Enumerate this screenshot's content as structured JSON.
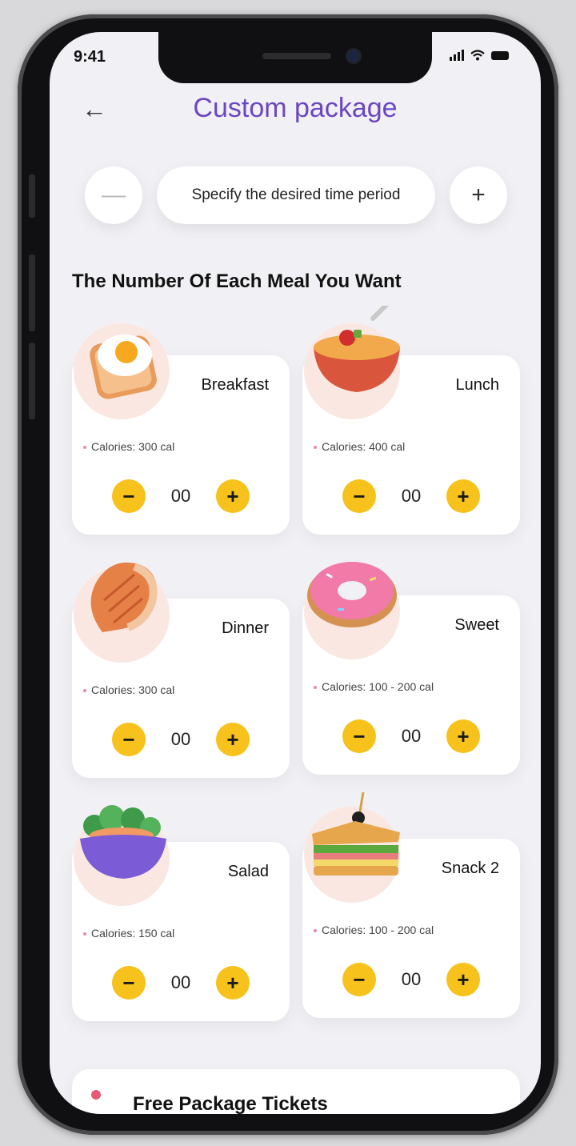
{
  "status_bar": {
    "time": "9:41"
  },
  "header": {
    "title": "Custom package"
  },
  "period": {
    "minus_label": "—",
    "label": "Specify the desired time period",
    "plus_label": "+"
  },
  "section": {
    "title": "The Number Of Each Meal You Want"
  },
  "meals": [
    {
      "name": "Breakfast",
      "calories": "Calories: 300 cal",
      "count": "00"
    },
    {
      "name": "Lunch",
      "calories": "Calories: 400 cal",
      "count": "00"
    },
    {
      "name": "Dinner",
      "calories": "Calories: 300 cal",
      "count": "00"
    },
    {
      "name": "Sweet",
      "calories": "Calories: 100 - 200 cal",
      "count": "00"
    },
    {
      "name": "Salad",
      "calories": "Calories: 150 cal",
      "count": "00"
    },
    {
      "name": "Snack 2",
      "calories": "Calories: 100 - 200  cal",
      "count": "00"
    }
  ],
  "controls": {
    "minus": "−",
    "plus": "+"
  },
  "bottom": {
    "title": "Free Package Tickets"
  },
  "icons": [
    "back-arrow-icon",
    "signal-icon",
    "wifi-icon",
    "battery-icon"
  ],
  "colors": {
    "accent": "#6b46c1",
    "button": "#f6c21b",
    "blob": "#fbe7e1"
  }
}
